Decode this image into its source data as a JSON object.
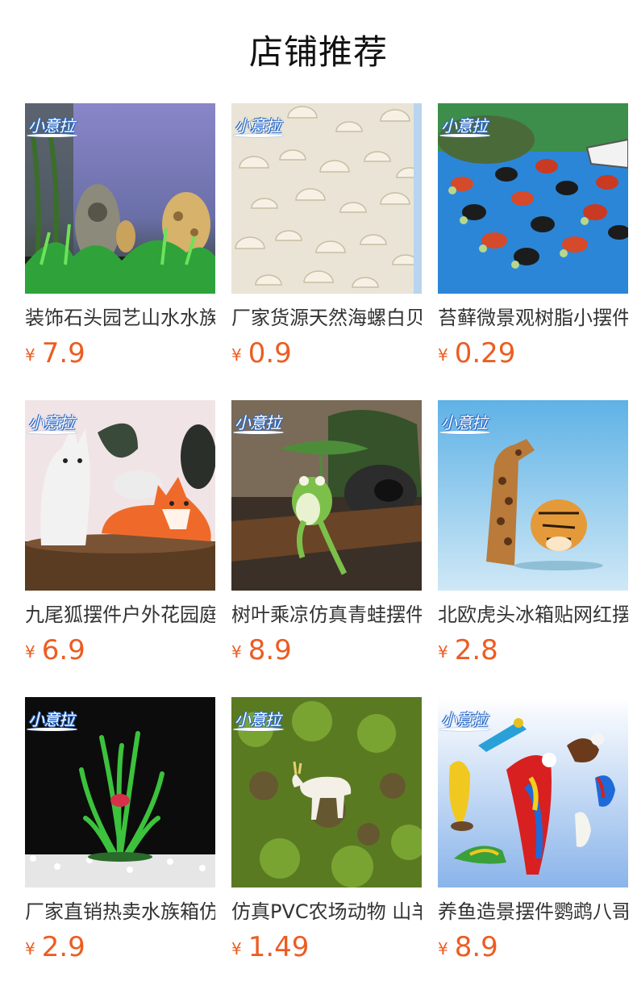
{
  "header": {
    "title": "店铺推荐"
  },
  "brand_logo": "小意拉",
  "products": [
    {
      "name": "装饰石头园艺山水水族箱造景石",
      "currency": "¥",
      "price": "7.9"
    },
    {
      "name": "厂家货源天然海螺白贝壳",
      "currency": "¥",
      "price": "0.9"
    },
    {
      "name": "苔藓微景观树脂小摆件乌龟",
      "currency": "¥",
      "price": "0.29"
    },
    {
      "name": "九尾狐摆件户外花园庭院",
      "currency": "¥",
      "price": "6.9"
    },
    {
      "name": "树叶乘凉仿真青蛙摆件",
      "currency": "¥",
      "price": "8.9"
    },
    {
      "name": "北欧虎头冰箱贴网红摆件",
      "currency": "¥",
      "price": "2.8"
    },
    {
      "name": "厂家直销热卖水族箱仿真水草",
      "currency": "¥",
      "price": "2.9"
    },
    {
      "name": "仿真PVC农场动物 山羊模型",
      "currency": "¥",
      "price": "1.49"
    },
    {
      "name": "养鱼造景摆件鹦鹉八哥",
      "currency": "¥",
      "price": "8.9"
    }
  ]
}
